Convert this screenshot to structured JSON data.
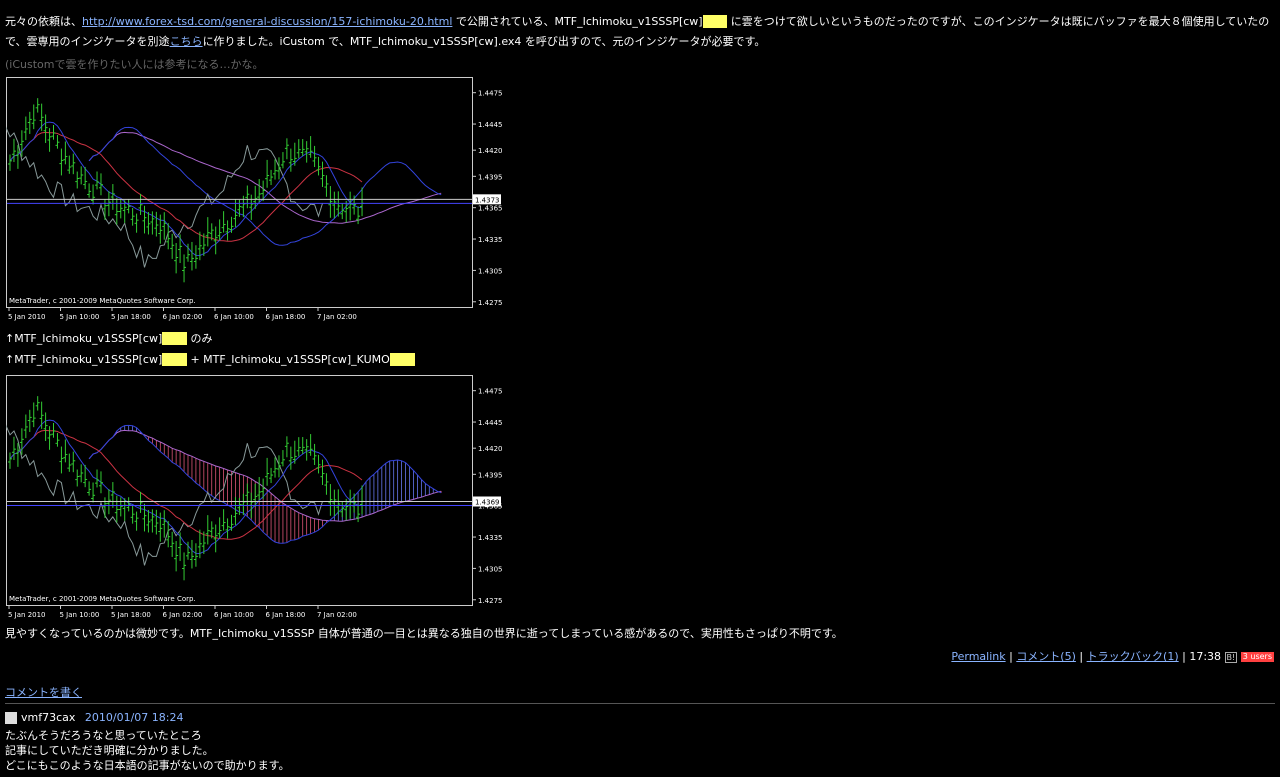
{
  "article": {
    "para1_a": "元々の依頼は、",
    "link1": "http://www.forex-tsd.com/general-discussion/157-ichimoku-20.html",
    "para1_b": " で公開されている、MTF_Ichimoku_v1SSSP[cw]",
    "hl1": "mq4",
    "para1_c": " に雲をつけて欲しいというものだったのですが、このインジケータは既にバッファを最大８個使用していたので、雲専用のインジケータを別途",
    "link2": "こちら",
    "para1_d": "に作りました。iCustom で、MTF_Ichimoku_v1SSSP[cw].ex4 を呼び出すので、元のインジケータが必要です。",
    "note": "(iCustomで雲を作りたい人には参考になる…かな。",
    "caption1_a": "↑MTF_Ichimoku_v1SSSP[cw]",
    "caption1_hl": "mq4",
    "caption1_b": " のみ",
    "caption2_a": "↑MTF_Ichimoku_v1SSSP[cw]",
    "caption2_hl": "mq4",
    "caption2_b": " + MTF_Ichimoku_v1SSSP[cw]_KUMO",
    "caption2_hl2": "mq4",
    "conclusion": "見やすくなっているのかは微妙です。MTF_Ichimoku_v1SSSP 自体が普通の一目とは異なる独自の世界に逝ってしまっている感があるので、実用性もさっぱり不明です。"
  },
  "footer": {
    "permalink": "Permalink",
    "comments": "コメント(5)",
    "trackbacks": "トラックバック(1)",
    "time": "17:38",
    "hatena": "B!",
    "users": "3 users"
  },
  "write_comment": "コメントを書く",
  "comment": {
    "author": "vmf73cax",
    "date": "2010/01/07 18:24",
    "line1": "たぶんそうだろうなと思っていたところ",
    "line2": "記事にしていただき明確に分かりました。",
    "line3": "どこにもこのような日本語の記事がないので助かります。"
  },
  "chart_data": [
    {
      "type": "line",
      "watermark": "MetaTrader, c 2001-2009 MetaQuotes Software Corp.",
      "y_ticks": [
        "1.4475",
        "1.4445",
        "1.4420",
        "1.4395",
        "1.4365",
        "1.4335",
        "1.4305",
        "1.4275"
      ],
      "x_ticks": [
        "5 Jan 2010",
        "5 Jan 10:00",
        "5 Jan 18:00",
        "6 Jan 02:00",
        "6 Jan 10:00",
        "6 Jan 18:00",
        "7 Jan 02:00"
      ],
      "price_label": "1.4373",
      "ylim": [
        1.427,
        1.449
      ]
    },
    {
      "type": "line",
      "watermark": "MetaTrader, c 2001-2009 MetaQuotes Software Corp.",
      "y_ticks": [
        "1.4475",
        "1.4445",
        "1.4420",
        "1.4395",
        "1.4365",
        "1.4335",
        "1.4305",
        "1.4275"
      ],
      "x_ticks": [
        "5 Jan 2010",
        "5 Jan 10:00",
        "5 Jan 18:00",
        "6 Jan 02:00",
        "6 Jan 10:00",
        "6 Jan 18:00",
        "7 Jan 02:00"
      ],
      "price_label": "1.4369",
      "ylim": [
        1.427,
        1.449
      ]
    }
  ],
  "colors": {
    "candle": "#33cc33",
    "tenkan": "#cc3344",
    "kijun": "#3344dd",
    "chikou": "#889999",
    "senkou": "#aa66cc",
    "cloud_up": "#6677ee",
    "cloud_down": "#dd5577"
  }
}
